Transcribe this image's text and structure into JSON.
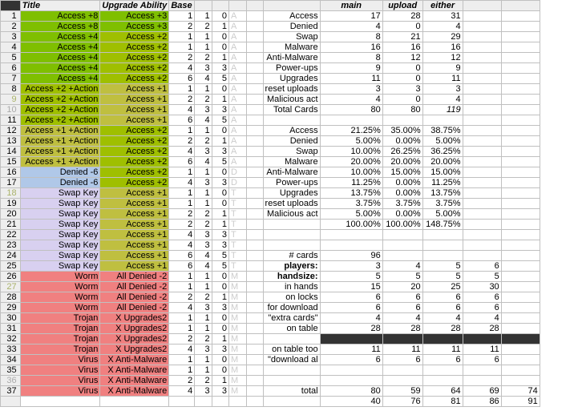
{
  "headers": {
    "title": "Title",
    "upgrade": "Upgrade Ability",
    "base": "Base",
    "main": "main",
    "upload": "upload",
    "either": "either"
  },
  "rows": [
    {
      "n": 1,
      "t": "Access +8",
      "u": "Access +3",
      "c": [
        1,
        1,
        0
      ],
      "k": "A",
      "tc": "g1",
      "uc": "g1"
    },
    {
      "n": 2,
      "t": "Access +8",
      "u": "Access +3",
      "c": [
        2,
        2,
        1
      ],
      "k": "A",
      "tc": "g1",
      "uc": "g1"
    },
    {
      "n": 3,
      "t": "Access +4",
      "u": "Access +2",
      "c": [
        1,
        1,
        0
      ],
      "k": "A",
      "tc": "g1",
      "uc": "g2"
    },
    {
      "n": 4,
      "t": "Access +4",
      "u": "Access +2",
      "c": [
        1,
        1,
        0
      ],
      "k": "A",
      "tc": "g1",
      "uc": "g2"
    },
    {
      "n": 5,
      "t": "Access +4",
      "u": "Access +2",
      "c": [
        2,
        2,
        1
      ],
      "k": "A",
      "tc": "g1",
      "uc": "g2"
    },
    {
      "n": 6,
      "t": "Access +4",
      "u": "Access +2",
      "c": [
        4,
        3,
        3
      ],
      "k": "A",
      "tc": "g1",
      "uc": "g2"
    },
    {
      "n": 7,
      "t": "Access +4",
      "u": "Access +2",
      "c": [
        6,
        4,
        5
      ],
      "k": "A",
      "tc": "g1",
      "uc": "g2"
    },
    {
      "n": 8,
      "t": "Access +2 +Action",
      "u": "Access +1",
      "c": [
        1,
        1,
        0
      ],
      "k": "A",
      "tc": "g2",
      "uc": "g3"
    },
    {
      "n": 9,
      "t": "Access +2 +Action",
      "u": "Access +1",
      "c": [
        2,
        2,
        1
      ],
      "k": "A",
      "tc": "g2",
      "uc": "g3",
      "rh": "y"
    },
    {
      "n": 10,
      "t": "Access +2 +Action",
      "u": "Access +1",
      "c": [
        4,
        3,
        3
      ],
      "k": "A",
      "tc": "g2",
      "uc": "g3",
      "rh": "g"
    },
    {
      "n": 11,
      "t": "Access +2 +Action",
      "u": "Access +1",
      "c": [
        6,
        4,
        5
      ],
      "k": "A",
      "tc": "g2",
      "uc": "g3"
    },
    {
      "n": 12,
      "t": "Access +1 +Action",
      "u": "Access +2",
      "c": [
        1,
        1,
        0
      ],
      "k": "A",
      "tc": "g3",
      "uc": "g2"
    },
    {
      "n": 13,
      "t": "Access +1 +Action",
      "u": "Access +2",
      "c": [
        2,
        2,
        1
      ],
      "k": "A",
      "tc": "g3",
      "uc": "g2"
    },
    {
      "n": 14,
      "t": "Access +1 +Action",
      "u": "Access +2",
      "c": [
        4,
        3,
        3
      ],
      "k": "A",
      "tc": "g3",
      "uc": "g2"
    },
    {
      "n": 15,
      "t": "Access +1 +Action",
      "u": "Access +2",
      "c": [
        6,
        4,
        5
      ],
      "k": "A",
      "tc": "g3",
      "uc": "g2"
    },
    {
      "n": 16,
      "t": "Denied -6",
      "u": "Access +2",
      "c": [
        1,
        1,
        0
      ],
      "k": "D",
      "tc": "bl",
      "uc": "g2"
    },
    {
      "n": 17,
      "t": "Denied -6",
      "u": "Access +2",
      "c": [
        4,
        3,
        3
      ],
      "k": "D",
      "tc": "bl",
      "uc": "g2"
    },
    {
      "n": 18,
      "t": "Swap Key",
      "u": "Access +1",
      "c": [
        1,
        1,
        0
      ],
      "k": "T",
      "tc": "pu",
      "uc": "g3",
      "rh": "y"
    },
    {
      "n": 19,
      "t": "Swap Key",
      "u": "Access +1",
      "c": [
        1,
        1,
        0
      ],
      "k": "T",
      "tc": "pu",
      "uc": "g3"
    },
    {
      "n": 20,
      "t": "Swap Key",
      "u": "Access +1",
      "c": [
        2,
        2,
        1
      ],
      "k": "T",
      "tc": "pu",
      "uc": "g3"
    },
    {
      "n": 21,
      "t": "Swap Key",
      "u": "Access +1",
      "c": [
        2,
        2,
        1
      ],
      "k": "T",
      "tc": "pu",
      "uc": "g3"
    },
    {
      "n": 22,
      "t": "Swap Key",
      "u": "Access +1",
      "c": [
        4,
        3,
        3
      ],
      "k": "T",
      "tc": "pu",
      "uc": "g3"
    },
    {
      "n": 23,
      "t": "Swap Key",
      "u": "Access +1",
      "c": [
        4,
        3,
        3
      ],
      "k": "T",
      "tc": "pu",
      "uc": "g3"
    },
    {
      "n": 24,
      "t": "Swap Key",
      "u": "Access +1",
      "c": [
        6,
        4,
        5
      ],
      "k": "T",
      "tc": "pu",
      "uc": "g3"
    },
    {
      "n": 25,
      "t": "Swap Key",
      "u": "Access +1",
      "c": [
        6,
        4,
        5
      ],
      "k": "T",
      "tc": "pu",
      "uc": "g3"
    },
    {
      "n": 26,
      "t": "Worm",
      "u": "All Denied -2",
      "c": [
        1,
        1,
        0
      ],
      "k": "M",
      "tc": "rd",
      "uc": "rd"
    },
    {
      "n": 27,
      "t": "Worm",
      "u": "All Denied -2",
      "c": [
        1,
        1,
        0
      ],
      "k": "M",
      "tc": "rd",
      "uc": "rd",
      "rh": "y"
    },
    {
      "n": 28,
      "t": "Worm",
      "u": "All Denied -2",
      "c": [
        2,
        2,
        1
      ],
      "k": "M",
      "tc": "rd",
      "uc": "rd"
    },
    {
      "n": 29,
      "t": "Worm",
      "u": "All Denied -2",
      "c": [
        4,
        3,
        3
      ],
      "k": "M",
      "tc": "rd",
      "uc": "rd"
    },
    {
      "n": 30,
      "t": "Trojan",
      "u": "X Upgrades2",
      "c": [
        1,
        1,
        0
      ],
      "k": "M",
      "tc": "rd",
      "uc": "rd"
    },
    {
      "n": 31,
      "t": "Trojan",
      "u": "X Upgrades2",
      "c": [
        1,
        1,
        0
      ],
      "k": "M",
      "tc": "rd",
      "uc": "rd"
    },
    {
      "n": 32,
      "t": "Trojan",
      "u": "X Upgrades2",
      "c": [
        2,
        2,
        1
      ],
      "k": "M",
      "tc": "rd",
      "uc": "rd"
    },
    {
      "n": 33,
      "t": "Trojan",
      "u": "X Upgrades2",
      "c": [
        4,
        3,
        3
      ],
      "k": "M",
      "tc": "rd",
      "uc": "rd"
    },
    {
      "n": 34,
      "t": "Virus",
      "u": "X Anti-Malware",
      "c": [
        1,
        1,
        0
      ],
      "k": "M",
      "tc": "rd",
      "uc": "rd"
    },
    {
      "n": 35,
      "t": "Virus",
      "u": "X Anti-Malware",
      "c": [
        1,
        1,
        0
      ],
      "k": "M",
      "tc": "rd",
      "uc": "rd"
    },
    {
      "n": 36,
      "t": "Virus",
      "u": "X Anti-Malware",
      "c": [
        2,
        2,
        1
      ],
      "k": "M",
      "tc": "rd",
      "uc": "rd",
      "rh": "g"
    },
    {
      "n": 37,
      "t": "Virus",
      "u": "X Anti-Malware",
      "c": [
        4,
        3,
        3
      ],
      "k": "M",
      "tc": "rd",
      "uc": "rd"
    }
  ],
  "right": {
    "1": [
      "Access",
      "17",
      "28",
      "31"
    ],
    "2": [
      "Denied",
      "4",
      "0",
      "4"
    ],
    "3": [
      "Swap",
      "8",
      "21",
      "29"
    ],
    "4": [
      "Malware",
      "16",
      "16",
      "16"
    ],
    "5": [
      "Anti-Malware",
      "8",
      "12",
      "12"
    ],
    "6": [
      "Power-ups",
      "9",
      "0",
      "9"
    ],
    "7": [
      "Upgrades",
      "11",
      "0",
      "11"
    ],
    "8": [
      "reset uploads",
      "3",
      "3",
      "3"
    ],
    "9": [
      "Malicious act",
      "4",
      "0",
      "4"
    ],
    "10": [
      "Total Cards",
      "80",
      "80",
      "119"
    ],
    "12": [
      "Access",
      "21.25%",
      "35.00%",
      "38.75%"
    ],
    "13": [
      "Denied",
      "5.00%",
      "0.00%",
      "5.00%"
    ],
    "14": [
      "Swap",
      "10.00%",
      "26.25%",
      "36.25%"
    ],
    "15": [
      "Malware",
      "20.00%",
      "20.00%",
      "20.00%"
    ],
    "16": [
      "Anti-Malware",
      "10.00%",
      "15.00%",
      "15.00%"
    ],
    "17": [
      "Power-ups",
      "11.25%",
      "0.00%",
      "11.25%"
    ],
    "18": [
      "Upgrades",
      "13.75%",
      "0.00%",
      "13.75%"
    ],
    "19": [
      "reset uploads",
      "3.75%",
      "3.75%",
      "3.75%"
    ],
    "20": [
      "Malicious act",
      "5.00%",
      "0.00%",
      "5.00%"
    ],
    "21": [
      "",
      "100.00%",
      "100.00%",
      "148.75%"
    ],
    "24": [
      "# cards",
      "96",
      "",
      "",
      ""
    ],
    "25": [
      "players:",
      "3",
      "4",
      "5",
      "6"
    ],
    "26": [
      "handsize:",
      "5",
      "5",
      "5",
      "5"
    ],
    "27": [
      "in hands",
      "15",
      "20",
      "25",
      "30"
    ],
    "28": [
      "on locks",
      "6",
      "6",
      "6",
      "6"
    ],
    "29": [
      "for download",
      "6",
      "6",
      "6",
      "6"
    ],
    "30": [
      "\"extra cards\"",
      "4",
      "4",
      "4",
      "4"
    ],
    "31": [
      "on table",
      "28",
      "28",
      "28",
      "28"
    ],
    "33": [
      "on table too",
      "11",
      "11",
      "11",
      "11"
    ],
    "34": [
      "\"download al",
      "6",
      "6",
      "6",
      "6"
    ],
    "37": [
      "total",
      "80",
      "59",
      "64",
      "69",
      "74"
    ]
  },
  "extra": {
    "c2": "40",
    "c3": "76",
    "c4": "81",
    "c5": "86",
    "c6": "91"
  },
  "italicLast": {
    "10": true
  },
  "boldLabel": {
    "25": true,
    "26": true
  },
  "blackRow": 32
}
